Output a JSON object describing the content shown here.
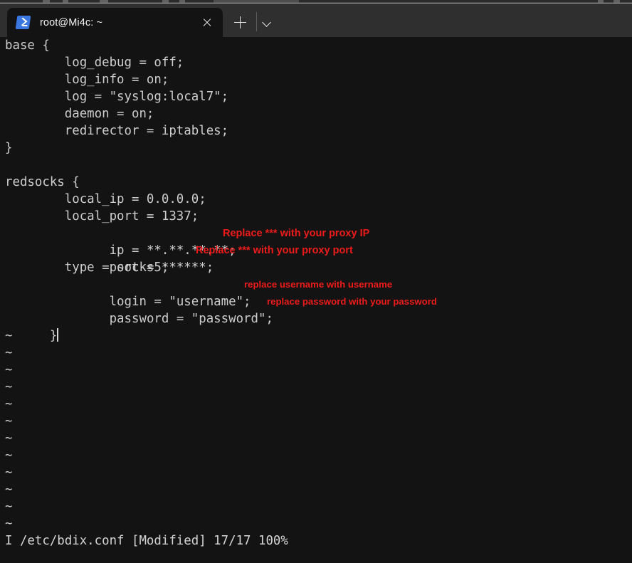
{
  "window": {
    "titlebar_bg": "#2f2f2f",
    "terminal_bg": "#131313",
    "accent_red": "#ef1b1b",
    "tab_icon_blue": "#3a77e0"
  },
  "tab": {
    "icon": "powershell-prompt-icon",
    "title": "root@Mi4c: ~",
    "close_icon": "close-icon",
    "new_tab_icon": "plus-icon",
    "dropdown_icon": "chevron-down-icon"
  },
  "terminal": {
    "lines": [
      "base {",
      "        log_debug = off;",
      "        log_info = on;",
      "        log = \"syslog:local7\";",
      "        daemon = on;",
      "        redirector = iptables;",
      "}",
      "",
      "redsocks {",
      "        local_ip = 0.0.0.0;",
      "        local_port = 1337;",
      "        ip = **.**.**.**;",
      "        port = ******;",
      "        type = socks5;",
      "        login = \"username\";",
      "        password = \"password\";",
      "}"
    ],
    "tildes": [
      "~",
      "~",
      "~",
      "~",
      "~",
      "~",
      "~",
      "~",
      "~",
      "~",
      "~",
      "~"
    ],
    "annotations": {
      "ip": "Replace *** with your proxy IP",
      "port": "Replace *** with your proxy port",
      "login": "replace username with username",
      "password": "replace password with your password"
    },
    "status_line": "I /etc/bdix.conf [Modified] 17/17 100%"
  }
}
